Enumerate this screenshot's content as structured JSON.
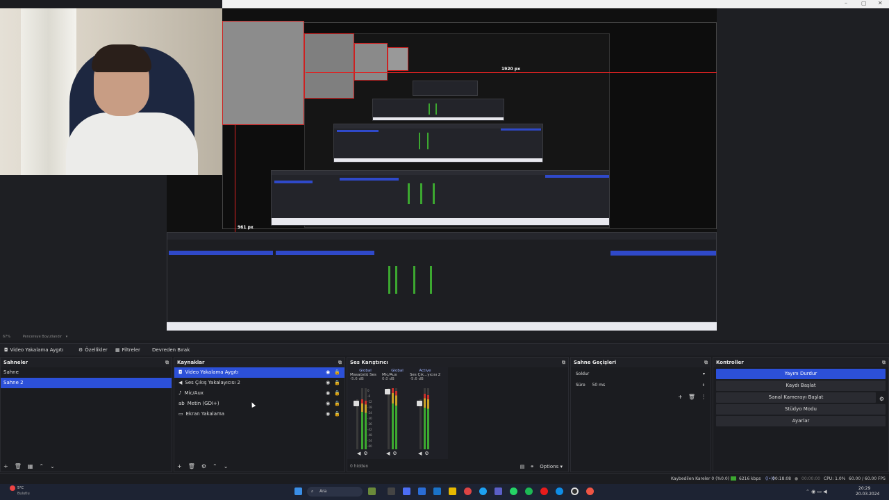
{
  "preview": {
    "width_label": "1920 px",
    "height_label": "961 px",
    "zoom_text": "67%",
    "fit_label": "Pencereye Boyutlandır"
  },
  "toolbar": {
    "source_name": "Video Yakalama Aygıtı",
    "properties": "Özellikler",
    "filters": "Filtreler",
    "deactivate": "Devreden Bırak"
  },
  "scenes": {
    "title": "Sahneler",
    "items": [
      "Sahne",
      "Sahne 2"
    ],
    "selected": 1
  },
  "sources": {
    "title": "Kaynaklar",
    "items": [
      {
        "name": "Video Yakalama Aygıtı",
        "icon": "camera-icon"
      },
      {
        "name": "Ses Çıkış Yakalayıcısı 2",
        "icon": "speaker-icon"
      },
      {
        "name": "Mic/Aux",
        "icon": "mic-icon"
      },
      {
        "name": "Metin (GDI+)",
        "icon": "text-icon"
      },
      {
        "name": "Ekran Yakalama",
        "icon": "monitor-icon"
      }
    ]
  },
  "mixer": {
    "title": "Ses Karıştırıcı",
    "channels": [
      {
        "tag": "Global",
        "name": "Masaüstü Ses",
        "db": "-5.6 dB"
      },
      {
        "tag": "Global",
        "name": "Mic/Aux",
        "db": "0.0 dB"
      },
      {
        "tag": "Active",
        "name": "Ses Çık...yıcısı 2",
        "db": "-5.6 dB"
      }
    ],
    "scale": [
      "0",
      "-6",
      "-12",
      "-18",
      "-24",
      "-30",
      "-36",
      "-42",
      "-48",
      "-54",
      "-60"
    ],
    "hidden": "0 hidden",
    "options": "Options"
  },
  "transitions": {
    "title": "Sahne Geçişleri",
    "type": "Soldur",
    "duration_label": "Süre",
    "duration_value": "50 ms"
  },
  "controls": {
    "title": "Kontroller",
    "buttons": [
      "Yayını Durdur",
      "Kaydı Başlat",
      "Sanal Kamerayı Başlat",
      "Stüdyo Modu",
      "Ayarlar"
    ]
  },
  "status": {
    "dropped": "Kaybedilen Kareler 0 (%0.0)",
    "bitrate": "6216 kbps",
    "live_time": "00:18:08",
    "rec_time": "00:00:00",
    "cpu": "CPU: 1.0%",
    "fps": "60.00 / 60.00 FPS"
  },
  "taskbar": {
    "weather_temp": "5°C",
    "weather_desc": "Bulutlu",
    "search": "Ara",
    "time": "20:29",
    "date": "20.03.2024"
  },
  "colors": {
    "accent": "#2c50d8",
    "meter_green": "#3ca830",
    "meter_red": "#c8302a",
    "guide_red": "#d22222"
  }
}
